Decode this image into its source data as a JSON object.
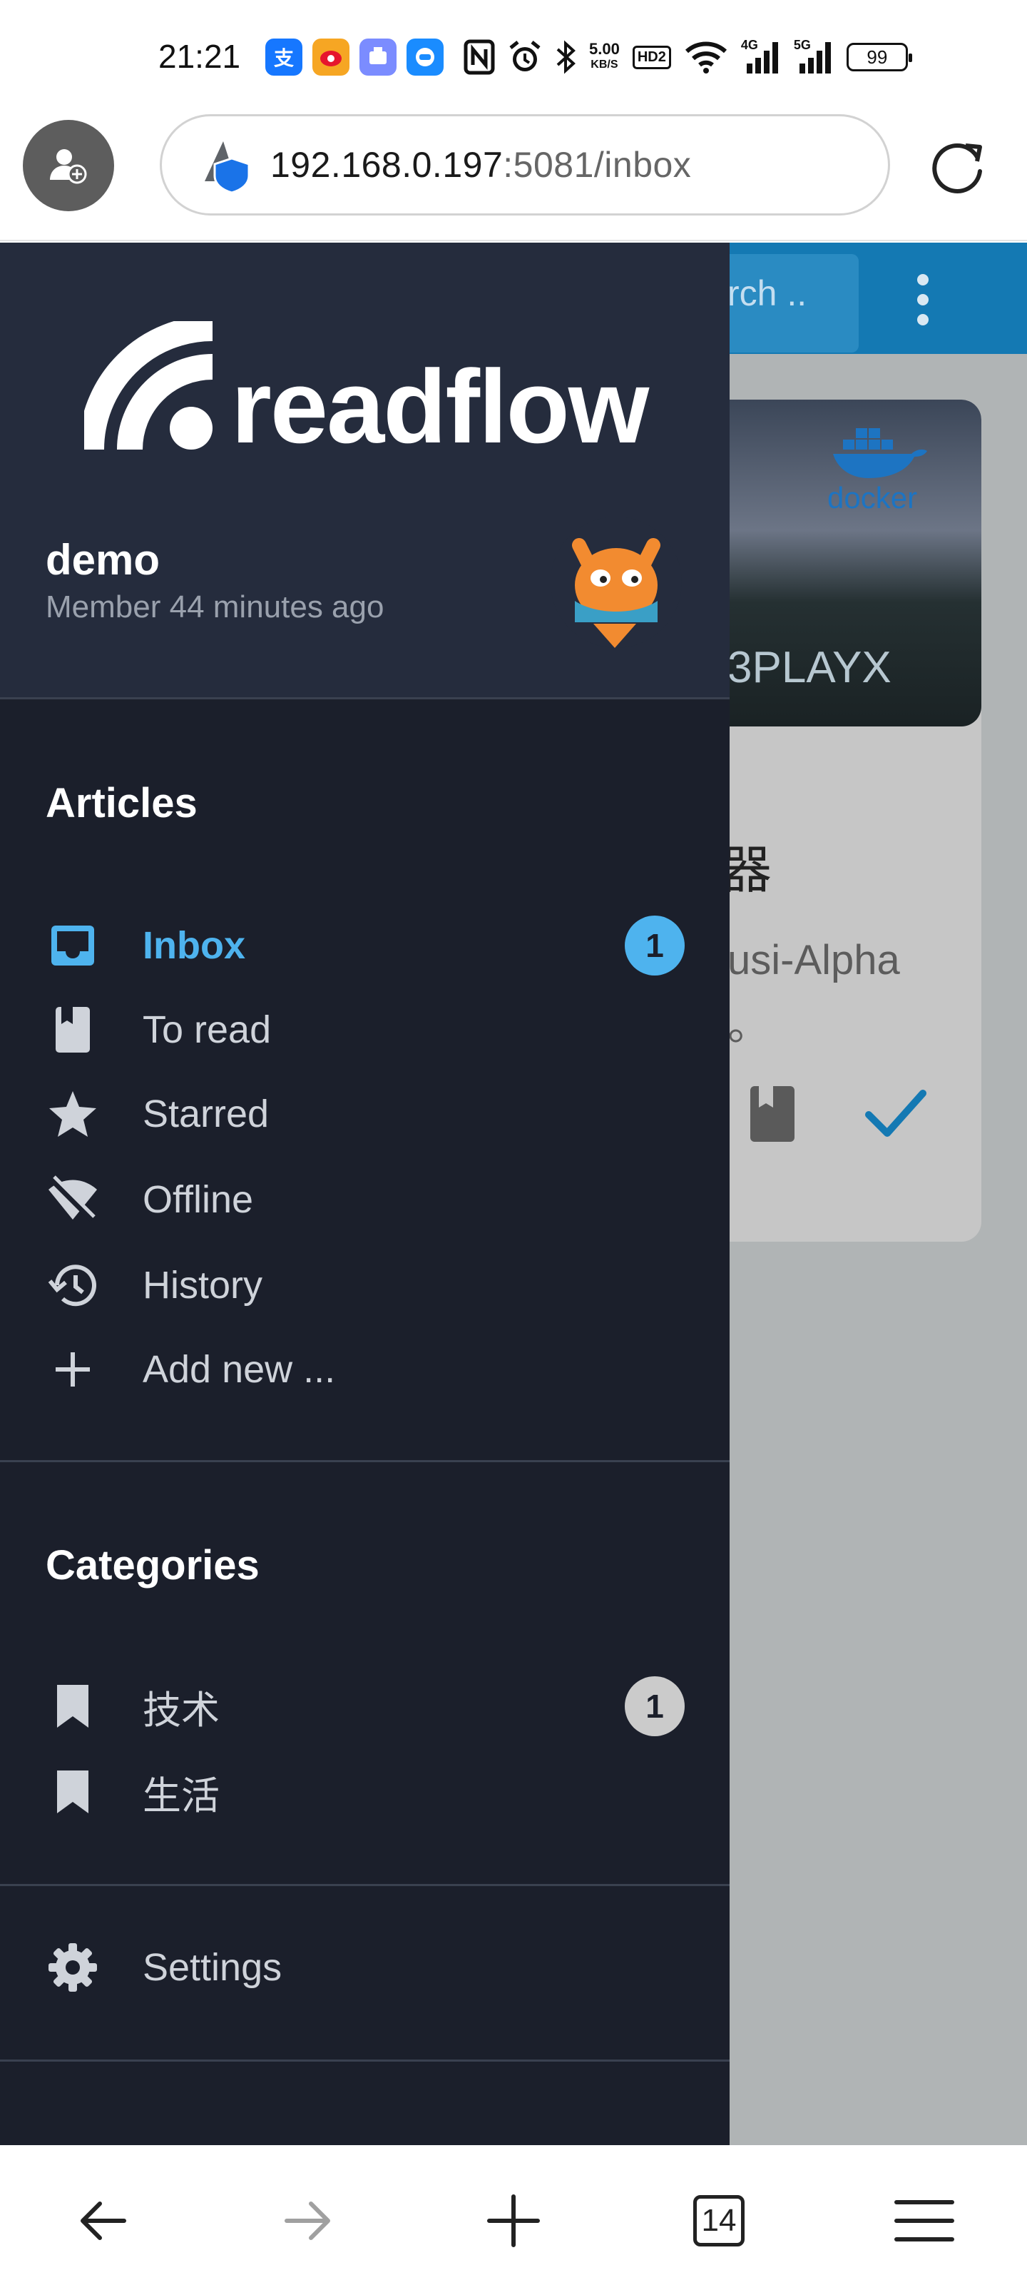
{
  "status_bar": {
    "time": "21:21",
    "net_speed_value": "5.00",
    "net_speed_unit": "KB/S",
    "hd_label": "HD2",
    "signal_4g": "4G",
    "signal_5g": "5G",
    "battery": "99"
  },
  "browser": {
    "url_host": "192.168.0.197",
    "url_rest": ":5081/inbox"
  },
  "page": {
    "search_partial": "rch ..",
    "card_image_text": "3PLAYX",
    "card_image_logo": "docker",
    "card_title_partial": "器",
    "card_subtitle_partial": "usi-Alpha",
    "card_punct": "。"
  },
  "drawer": {
    "logo_text": "readflow",
    "user": {
      "name": "demo",
      "member_since": "Member 44 minutes ago"
    },
    "articles": {
      "title": "Articles",
      "items": [
        {
          "label": "Inbox",
          "icon": "inbox-icon",
          "badge": "1",
          "active": true
        },
        {
          "label": "To read",
          "icon": "book-icon"
        },
        {
          "label": "Starred",
          "icon": "star-icon"
        },
        {
          "label": "Offline",
          "icon": "wifi-off-icon"
        },
        {
          "label": "History",
          "icon": "history-icon"
        },
        {
          "label": "Add new ...",
          "icon": "plus-icon"
        }
      ]
    },
    "categories": {
      "title": "Categories",
      "items": [
        {
          "label": "技术",
          "icon": "bookmark-icon",
          "badge": "1"
        },
        {
          "label": "生活",
          "icon": "bookmark-icon"
        }
      ]
    },
    "settings": {
      "label": "Settings",
      "icon": "gear-icon"
    }
  },
  "bottom_nav": {
    "tab_count": "14"
  },
  "colors": {
    "drawer_bg": "#1b1f2b",
    "drawer_header_bg": "#252c3d",
    "accent": "#4eb3ee",
    "app_header": "#1479b3"
  }
}
